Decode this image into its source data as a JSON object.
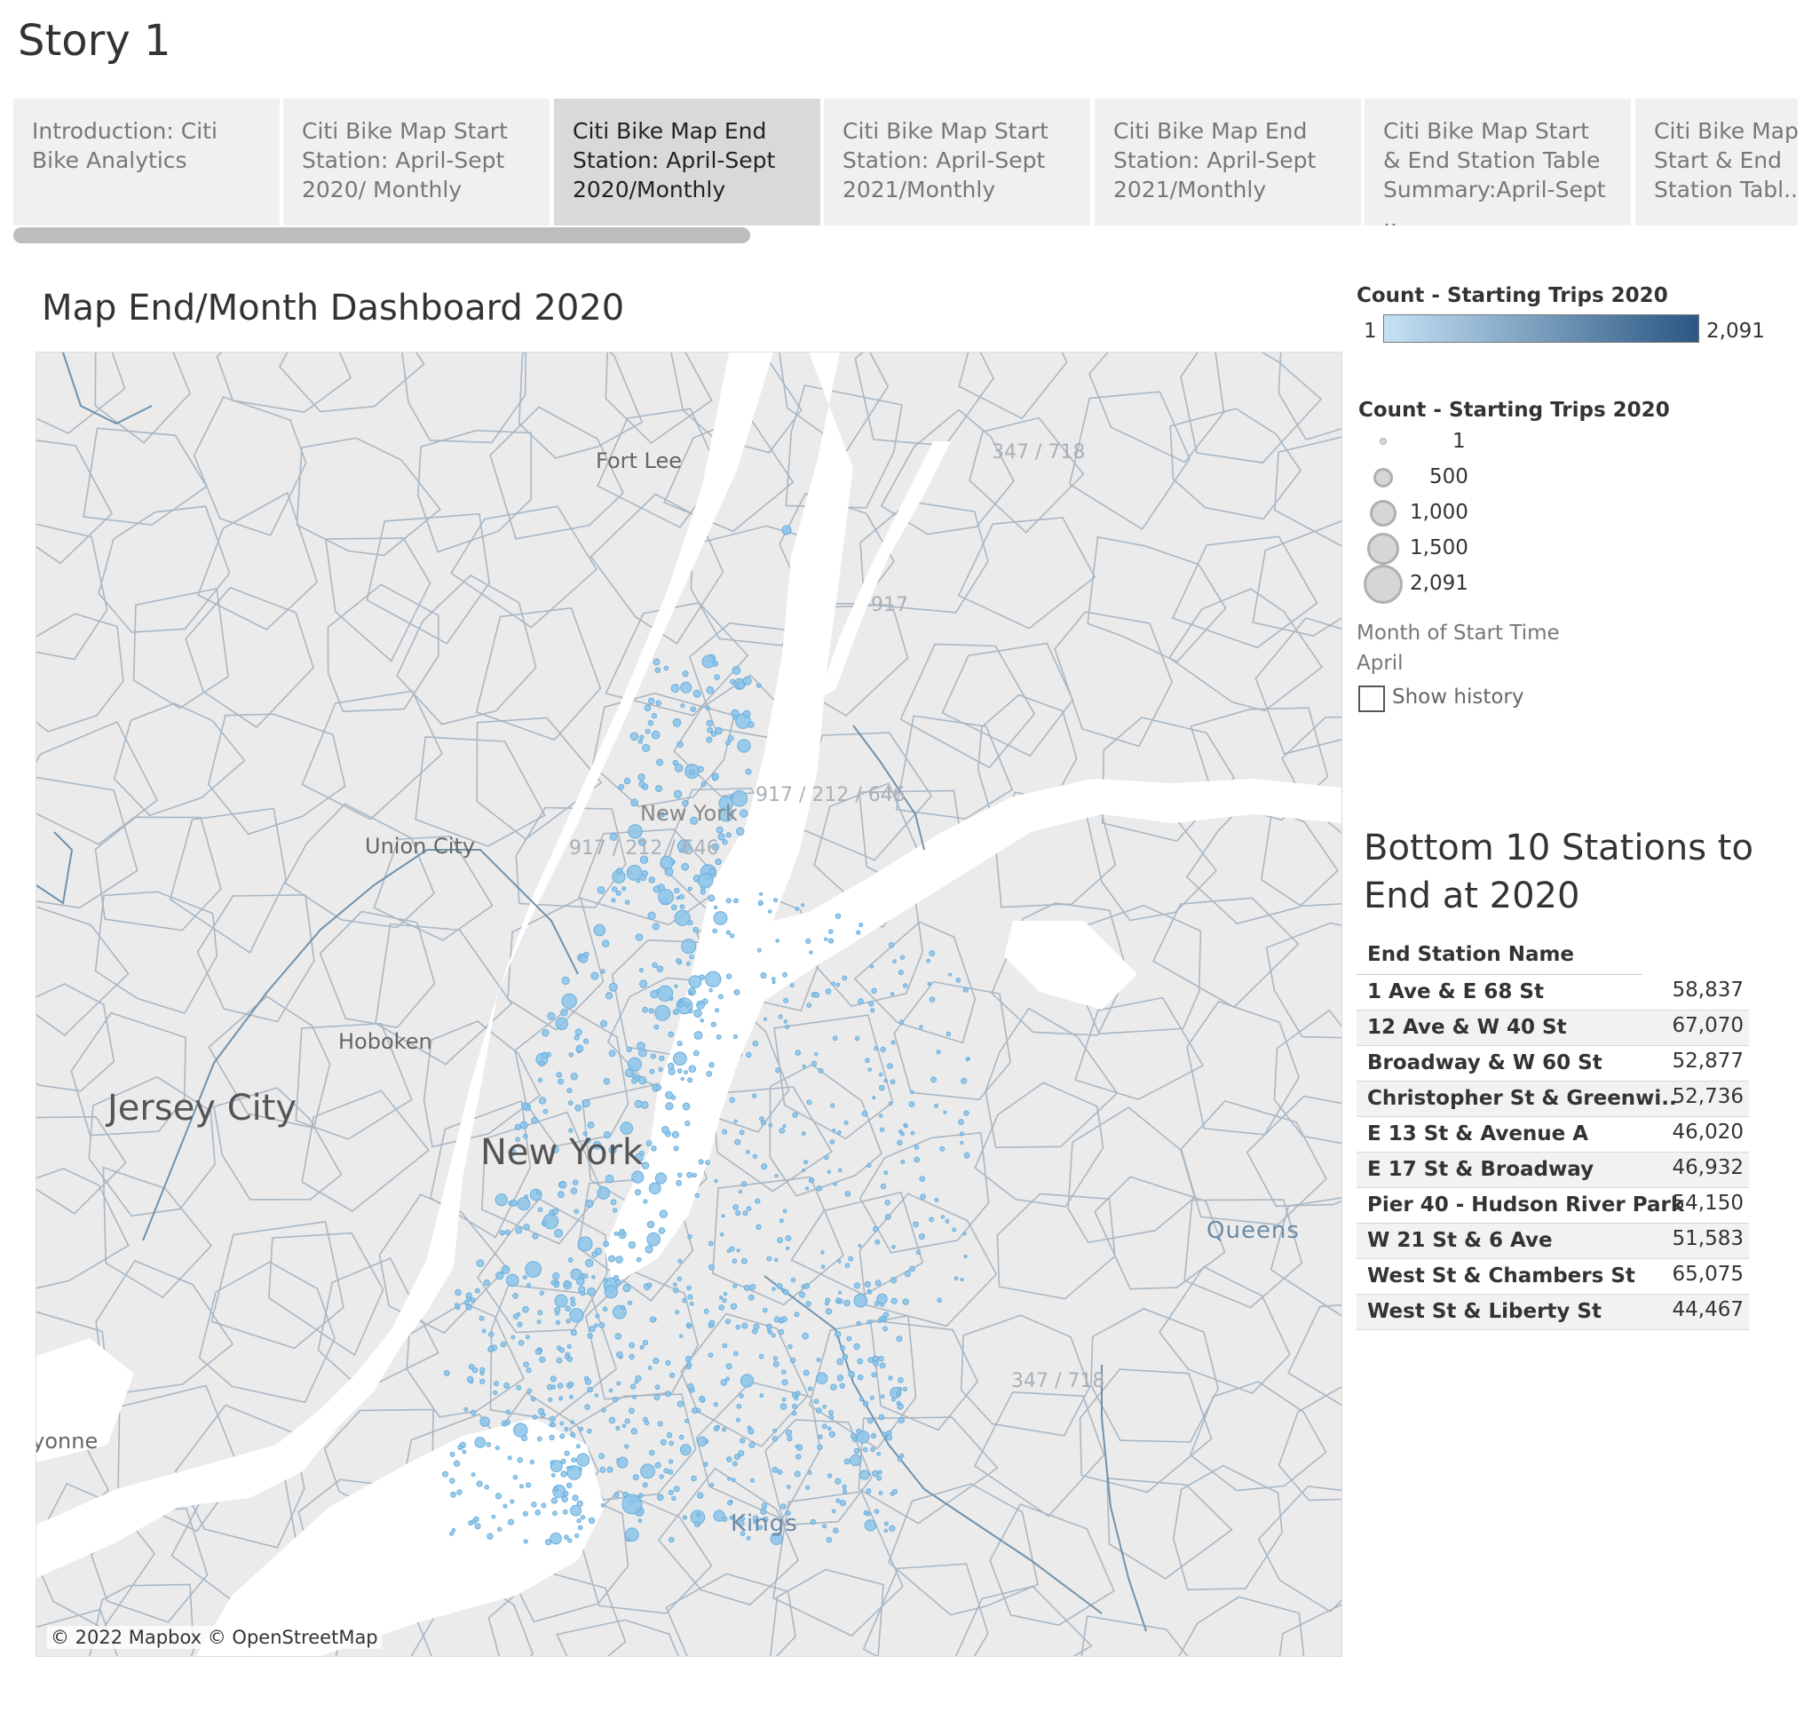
{
  "story": {
    "title": "Story 1"
  },
  "tabs": [
    {
      "label": "Introduction: Citi Bike Analytics"
    },
    {
      "label": "Citi Bike Map Start Station: April-Sept 2020/ Monthly"
    },
    {
      "label": "Citi Bike Map End Station: April-Sept 2020/Monthly"
    },
    {
      "label": "Citi  Bike Map Start Station: April-Sept 2021/Monthly"
    },
    {
      "label": "Citi Bike Map End Station: April-Sept 2021/Monthly"
    },
    {
      "label": "Citi Bike Map Start & End Station Table Summary:April-Sept .."
    },
    {
      "label": "Citi Bike Map Start & End Station Tabl.."
    }
  ],
  "active_tab_index": 2,
  "dashboard": {
    "title": "Map End/Month Dashboard 2020"
  },
  "map": {
    "labels": {
      "fort_lee": "Fort Lee",
      "code_347_718_top": "347 / 718",
      "code_917": "917",
      "code_917_212_646": "917 / 212 / 646",
      "new_york_small": "New York",
      "code_212_646": "917 / 212 / 646",
      "union_city": "Union City",
      "hoboken": "Hoboken",
      "jersey_city": "Jersey City",
      "new_york_big": "New York",
      "queens": "Queens",
      "code_347_718_bottom": "347 / 718",
      "bayonne": "Bayonne",
      "kings": "Kings"
    },
    "attribution": "© 2022 Mapbox © OpenStreetMap",
    "colors": {
      "water": "#ffffff",
      "land": "#ebebeb",
      "border": "#a9b7c3",
      "marker": "#7fbde8"
    }
  },
  "color_legend": {
    "title": "Count - Starting Trips 2020",
    "min": "1",
    "max": "2,091",
    "color_low": "#c6e2f5",
    "color_high": "#2a5783"
  },
  "size_legend": {
    "title": "Count - Starting Trips 2020",
    "items": [
      {
        "label": "1"
      },
      {
        "label": "500"
      },
      {
        "label": "1,000"
      },
      {
        "label": "1,500"
      },
      {
        "label": "2,091"
      }
    ]
  },
  "filter": {
    "label": "Month of Start Time",
    "value": "April",
    "show_history": "Show history",
    "show_history_checked": false
  },
  "table": {
    "title": "Bottom 10 Stations to End at 2020",
    "header": "End Station Name",
    "rows": [
      {
        "name": "1 Ave & E 68 St",
        "value": "58,837"
      },
      {
        "name": "12 Ave & W 40 St",
        "value": "67,070"
      },
      {
        "name": "Broadway & W 60 St",
        "value": "52,877"
      },
      {
        "name": "Christopher St & Greenwi..",
        "value": "52,736"
      },
      {
        "name": "E 13 St & Avenue A",
        "value": "46,020"
      },
      {
        "name": "E 17 St & Broadway",
        "value": "46,932"
      },
      {
        "name": "Pier 40 - Hudson River Park",
        "value": "54,150"
      },
      {
        "name": "W 21 St & 6 Ave",
        "value": "51,583"
      },
      {
        "name": "West St & Chambers St",
        "value": "65,075"
      },
      {
        "name": "West St & Liberty St",
        "value": "44,467"
      }
    ]
  }
}
